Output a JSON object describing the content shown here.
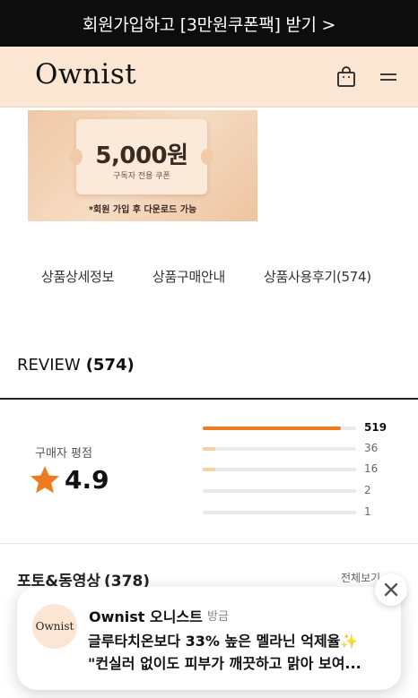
{
  "promo": {
    "text": "회원가입하고 [3만원쿠폰팩] 받기 >"
  },
  "header": {
    "logo": "Ownist",
    "cart_icon": "shopping-bag-icon",
    "menu_icon": "hamburger-menu-icon"
  },
  "coupon": {
    "amount": "5,000원",
    "subtitle": "구독자 전용 쿠폰",
    "note": "*회원 가입 후 다운로드 가능"
  },
  "tabs": [
    {
      "label": "상품상세정보"
    },
    {
      "label": "상품구매안내"
    },
    {
      "label": "상품사용후기(574)"
    }
  ],
  "review": {
    "title": "REVIEW",
    "count": "(574)",
    "rating_label": "구매자 평점",
    "rating_value": "4.9",
    "star_color": "#f07b1e",
    "distribution": [
      {
        "count": "519",
        "fraction": 0.9,
        "color": "#f07b1e"
      },
      {
        "count": "36",
        "fraction": 0.08,
        "color": "#f6cfa6"
      },
      {
        "count": "16",
        "fraction": 0.08,
        "color": "#f6cfa6"
      },
      {
        "count": "2",
        "fraction": 0.0,
        "color": "#f6cfa6"
      },
      {
        "count": "1",
        "fraction": 0.0,
        "color": "#f6cfa6"
      }
    ]
  },
  "photo_section": {
    "title": "포토&동영상",
    "count": "(378)",
    "view_all": "전체보기 >"
  },
  "toast": {
    "avatar_text": "Ownist",
    "brand": "Ownist 오니스트",
    "time": "방금",
    "line1": "글루타치온보다 33% 높은 멜라닌 억제율✨",
    "line2": "\"컨실러 없이도 피부가 깨끗하고 맑아 보여..."
  }
}
